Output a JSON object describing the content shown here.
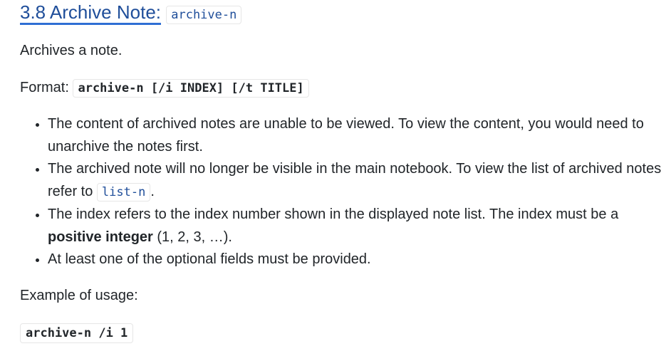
{
  "heading": {
    "title": "3.8 Archive Note:",
    "command": "archive-n"
  },
  "description": "Archives a note.",
  "format": {
    "label": "Format:",
    "syntax": "archive-n [/i INDEX] [/t TITLE]"
  },
  "bullets": [
    {
      "text": "The content of archived notes are unable to be viewed. To view the content, you would need to unarchive the notes first."
    },
    {
      "before": "The archived note will no longer be visible in the main notebook. To view the list of archived notes refer to ",
      "code": "list-n",
      "after": "."
    },
    {
      "before": "The index refers to the index number shown in the displayed note list. The index must be a ",
      "bold": "positive integer",
      "after": " (1, 2, 3, …)."
    },
    {
      "text": "At least one of the optional fields must be provided."
    }
  ],
  "example": {
    "label": "Example of usage:",
    "code": "archive-n /i 1"
  },
  "colors": {
    "link": "#1f4e9a",
    "underline": "#2f6fd4",
    "text": "#212529"
  }
}
